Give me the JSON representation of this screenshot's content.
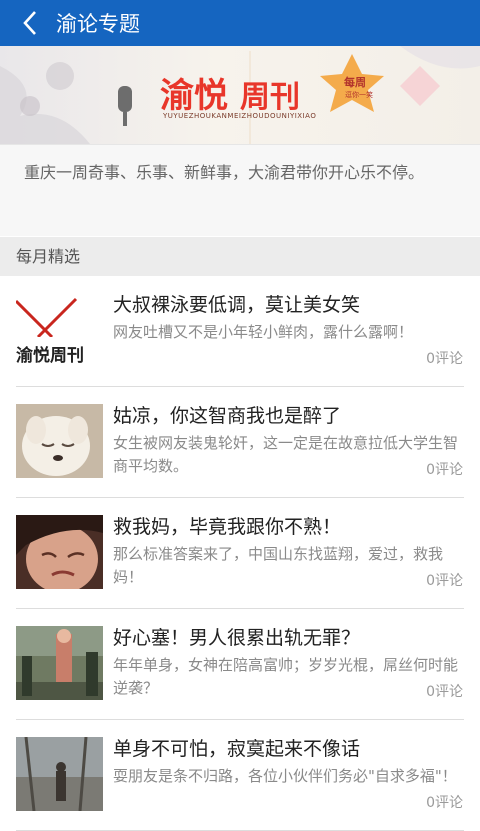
{
  "header": {
    "title": "渝论专题"
  },
  "banner": {
    "title_part1": "渝悦",
    "title_part2": "周刊",
    "subtitle": "YUYUEZHOUKANMEIZHOUDOUNIYIXIAO",
    "badge": "每周",
    "badge_sub": "逗你一笑"
  },
  "description": "重庆一周奇事、乐事、新鲜事，大渝君带你开心乐不停。",
  "section_title": "每月精选",
  "articles": [
    {
      "title": "大叔裸泳要低调，莫让美女笑",
      "summary": "网友吐槽又不是小年轻小鲜肉，露什么露啊！",
      "comments": "0",
      "comment_label": "评论",
      "thumb_text": "渝悦周刊"
    },
    {
      "title": "姑凉，你这智商我也是醉了",
      "summary": "女生被网友装鬼轮奸，这一定是在故意拉低大学生智商平均数。",
      "comments": "0",
      "comment_label": "评论"
    },
    {
      "title": "救我妈，毕竟我跟你不熟！",
      "summary": "那么标准答案来了，中国山东找蓝翔，爱过，救我妈！",
      "comments": "0",
      "comment_label": "评论"
    },
    {
      "title": "好心塞！男人很累出轨无罪？",
      "summary": "年年单身，女神在陪高富帅；岁岁光棍，屌丝何时能逆袭？",
      "comments": "0",
      "comment_label": "评论"
    },
    {
      "title": "单身不可怕，寂寞起来不像话",
      "summary": "耍朋友是条不归路，各位小伙伴们务必\"自求多福\"！",
      "comments": "0",
      "comment_label": "评论"
    }
  ]
}
